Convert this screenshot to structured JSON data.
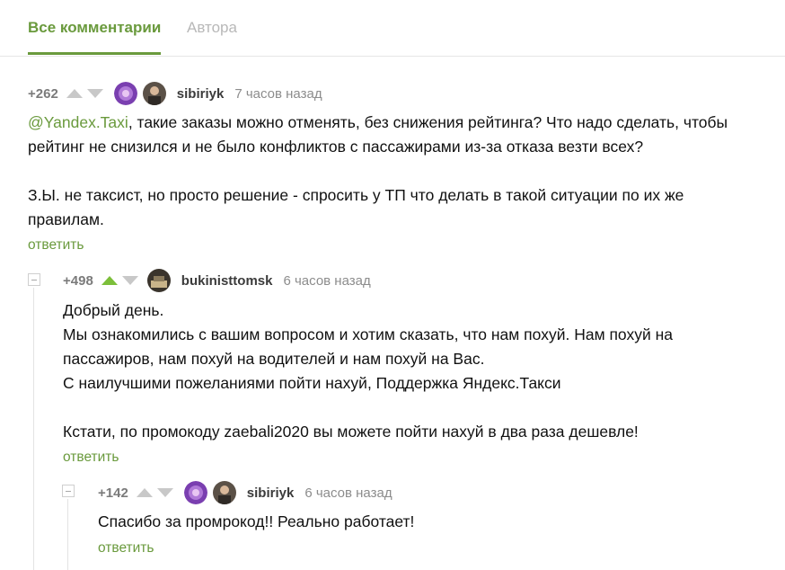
{
  "tabs": {
    "all_comments": "Все комментарии",
    "author": "Автора"
  },
  "comments": [
    {
      "rating": "+262",
      "username": "sibiriyk",
      "time": "7 часов назад",
      "mention": "@Yandex.Taxi",
      "line1_rest": ", такие заказы можно отменять, без снижения рейтинга? Что надо сделать, чтобы",
      "line2": "рейтинг не снизился и не было конфликтов с пассажирами из-за отказа везти всех?",
      "line3": "З.Ы. не таксист, но просто решение - спросить у ТП что делать в такой ситуации по их же",
      "line4": "правилам.",
      "reply": "ответить"
    },
    {
      "rating": "+498",
      "username": "bukinisttomsk",
      "time": "6 часов назад",
      "line1": "Добрый день.",
      "line2": "Мы ознакомились с вашим вопросом и хотим сказать, что нам похуй. Нам похуй на",
      "line3": "пассажиров, нам похуй на водителей и нам похуй на Вас.",
      "line4": "С наилучшими пожеланиями пойти нахуй, Поддержка Яндекс.Такси",
      "line5": "Кстати, по промокоду zaebali2020 вы можете пойти нахуй в два раза дешевле!",
      "reply": "ответить"
    },
    {
      "rating": "+142",
      "username": "sibiriyk",
      "time": "6 часов назад",
      "line1": "Спасибо за промрокод!! Реально работает!",
      "reply": "ответить"
    }
  ],
  "colors": {
    "accent": "#6a9a3d",
    "muted": "#8c8c8c",
    "upvote_active": "#7cbf3a",
    "vote_inactive": "#c8c8c8"
  },
  "icons": {
    "upvote": "triangle-up-icon",
    "downvote": "triangle-down-icon",
    "collapse": "minus-square-icon",
    "community_avatar": "purple-flower-avatar",
    "user_avatar": "user-photo-avatar"
  }
}
